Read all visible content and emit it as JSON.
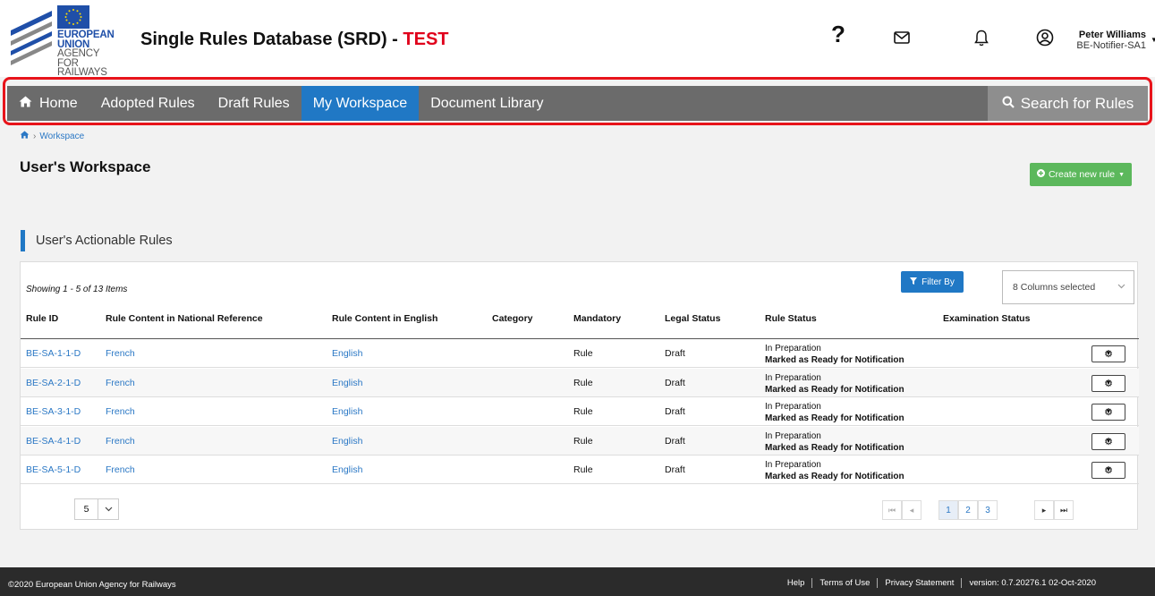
{
  "header": {
    "logo_lines": [
      "EUROPEAN",
      "UNION",
      "AGENCY",
      "FOR RAILWAYS"
    ],
    "title_main": "Single Rules Database (SRD) - ",
    "title_env": "TEST",
    "user_name": "Peter Williams",
    "user_role": "BE-Notifier-SA1",
    "icons": [
      "help-icon",
      "mail-icon",
      "bell-icon",
      "user-icon"
    ]
  },
  "nav": {
    "home": "Home",
    "adopted": "Adopted Rules",
    "draft": "Draft Rules",
    "workspace": "My Workspace",
    "library": "Document Library",
    "search": "Search for Rules"
  },
  "breadcrumb": {
    "current": "Workspace"
  },
  "page": {
    "title": "User's Workspace",
    "create_label": "Create new rule",
    "section_title": "User's Actionable Rules"
  },
  "table": {
    "showing": "Showing 1 - 5 of 13 Items",
    "filter_label": "Filter By",
    "columns_selected": "8 Columns selected",
    "headers": {
      "rule_id": "Rule ID",
      "national": "Rule Content in National Reference",
      "english": "Rule Content in English",
      "category": "Category",
      "mandatory": "Mandatory",
      "legal": "Legal Status",
      "status": "Rule Status",
      "exam": "Examination Status"
    },
    "rows": [
      {
        "id": "BE-SA-1-1-D",
        "national": "French",
        "english": "English",
        "mandatory": "Rule",
        "legal": "Draft",
        "status1": "In Preparation",
        "status2": "Marked as Ready for Notification"
      },
      {
        "id": "BE-SA-2-1-D",
        "national": "French",
        "english": "English",
        "mandatory": "Rule",
        "legal": "Draft",
        "status1": "In Preparation",
        "status2": "Marked as Ready for Notification"
      },
      {
        "id": "BE-SA-3-1-D",
        "national": "French",
        "english": "English",
        "mandatory": "Rule",
        "legal": "Draft",
        "status1": "In Preparation",
        "status2": "Marked as Ready for Notification"
      },
      {
        "id": "BE-SA-4-1-D",
        "national": "French",
        "english": "English",
        "mandatory": "Rule",
        "legal": "Draft",
        "status1": "In Preparation",
        "status2": "Marked as Ready for Notification"
      },
      {
        "id": "BE-SA-5-1-D",
        "national": "French",
        "english": "English",
        "mandatory": "Rule",
        "legal": "Draft",
        "status1": "In Preparation",
        "status2": "Marked as Ready for Notification"
      }
    ],
    "page_size": "5",
    "pages": [
      "1",
      "2",
      "3"
    ],
    "current_page": "1"
  },
  "footer": {
    "copyright": "©2020 European Union Agency for Railways",
    "help": "Help",
    "terms": "Terms of Use",
    "privacy": "Privacy Statement",
    "version": "version: 0.7.20276.1 02-Oct-2020"
  },
  "colors": {
    "nav_bg": "#6b6b6b",
    "nav_active": "#2078c5",
    "accent_link": "#2b78c5",
    "create_green": "#5cb85c",
    "test_red": "#e0001b",
    "highlight_outline": "#e8141b"
  }
}
